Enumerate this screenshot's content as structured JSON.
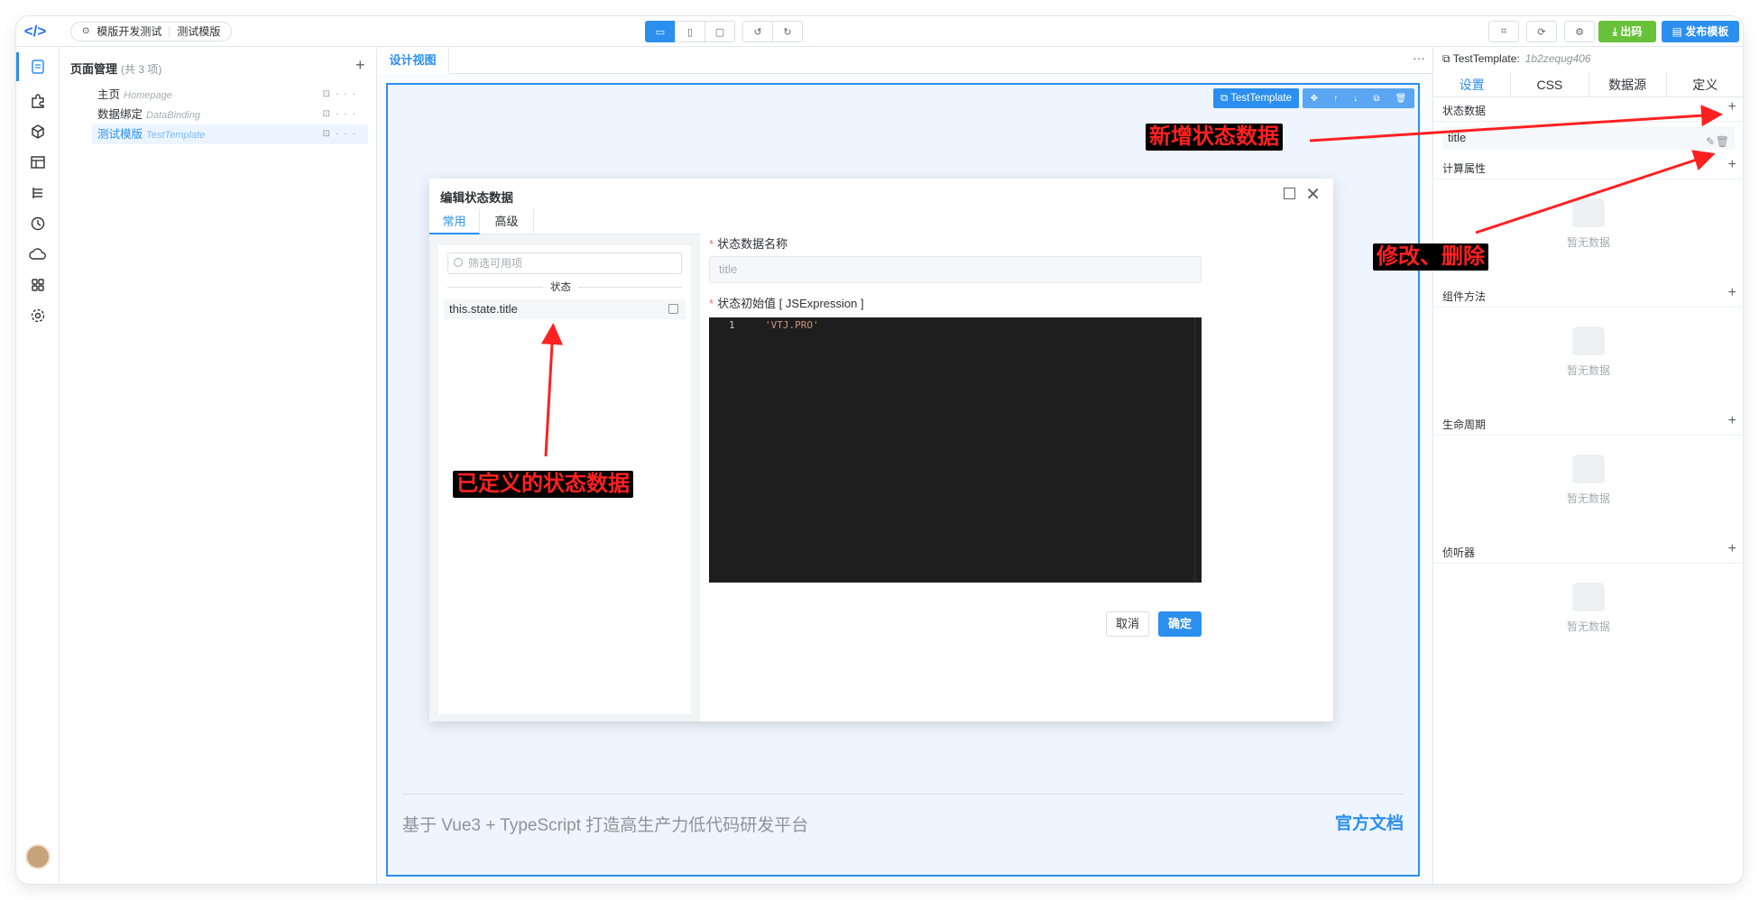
{
  "topbar": {
    "crumb_project": "模版开发测试",
    "crumb_page": "测试模版",
    "btn_code": "出码",
    "btn_publish": "发布模板"
  },
  "pages": {
    "title": "页面管理",
    "count": "(共 3 项)",
    "items": [
      {
        "name": "主页",
        "en": "Homepage"
      },
      {
        "name": "数据绑定",
        "en": "DataBinding"
      },
      {
        "name": "测试模版",
        "en": "TestTemplate"
      }
    ]
  },
  "center": {
    "tab": "设计视图",
    "tag": "TestTemplate",
    "footer_text": "基于 Vue3 + TypeScript 打造高生产力低代码研发平台",
    "footer_link": "官方文档"
  },
  "dialog": {
    "title": "编辑状态数据",
    "tab_common": "常用",
    "tab_advanced": "高级",
    "filter_placeholder": "筛选可用项",
    "group_label": "状态",
    "state_item": "this.state.title",
    "name_label": "状态数据名称",
    "name_value": "title",
    "init_label": "状态初始值 [ JSExpression ]",
    "line_no": "1",
    "code": "'VTJ.PRO'",
    "cancel": "取消",
    "ok": "确定"
  },
  "rpanel": {
    "head": "TestTemplate:",
    "id": "1b2zequg406",
    "tabs": [
      "设置",
      "CSS",
      "数据源",
      "定义"
    ],
    "state_title": "状态数据",
    "state_item": "title",
    "computed_title": "计算属性",
    "methods_title": "组件方法",
    "lifecycle_title": "生命周期",
    "watch_title": "侦听器",
    "empty_text": "暂无数据"
  },
  "annotations": {
    "add_state": "新增状态数据",
    "edit_delete": "修改、删除",
    "defined_state": "已定义的状态数据",
    "color": "#ff2020"
  }
}
